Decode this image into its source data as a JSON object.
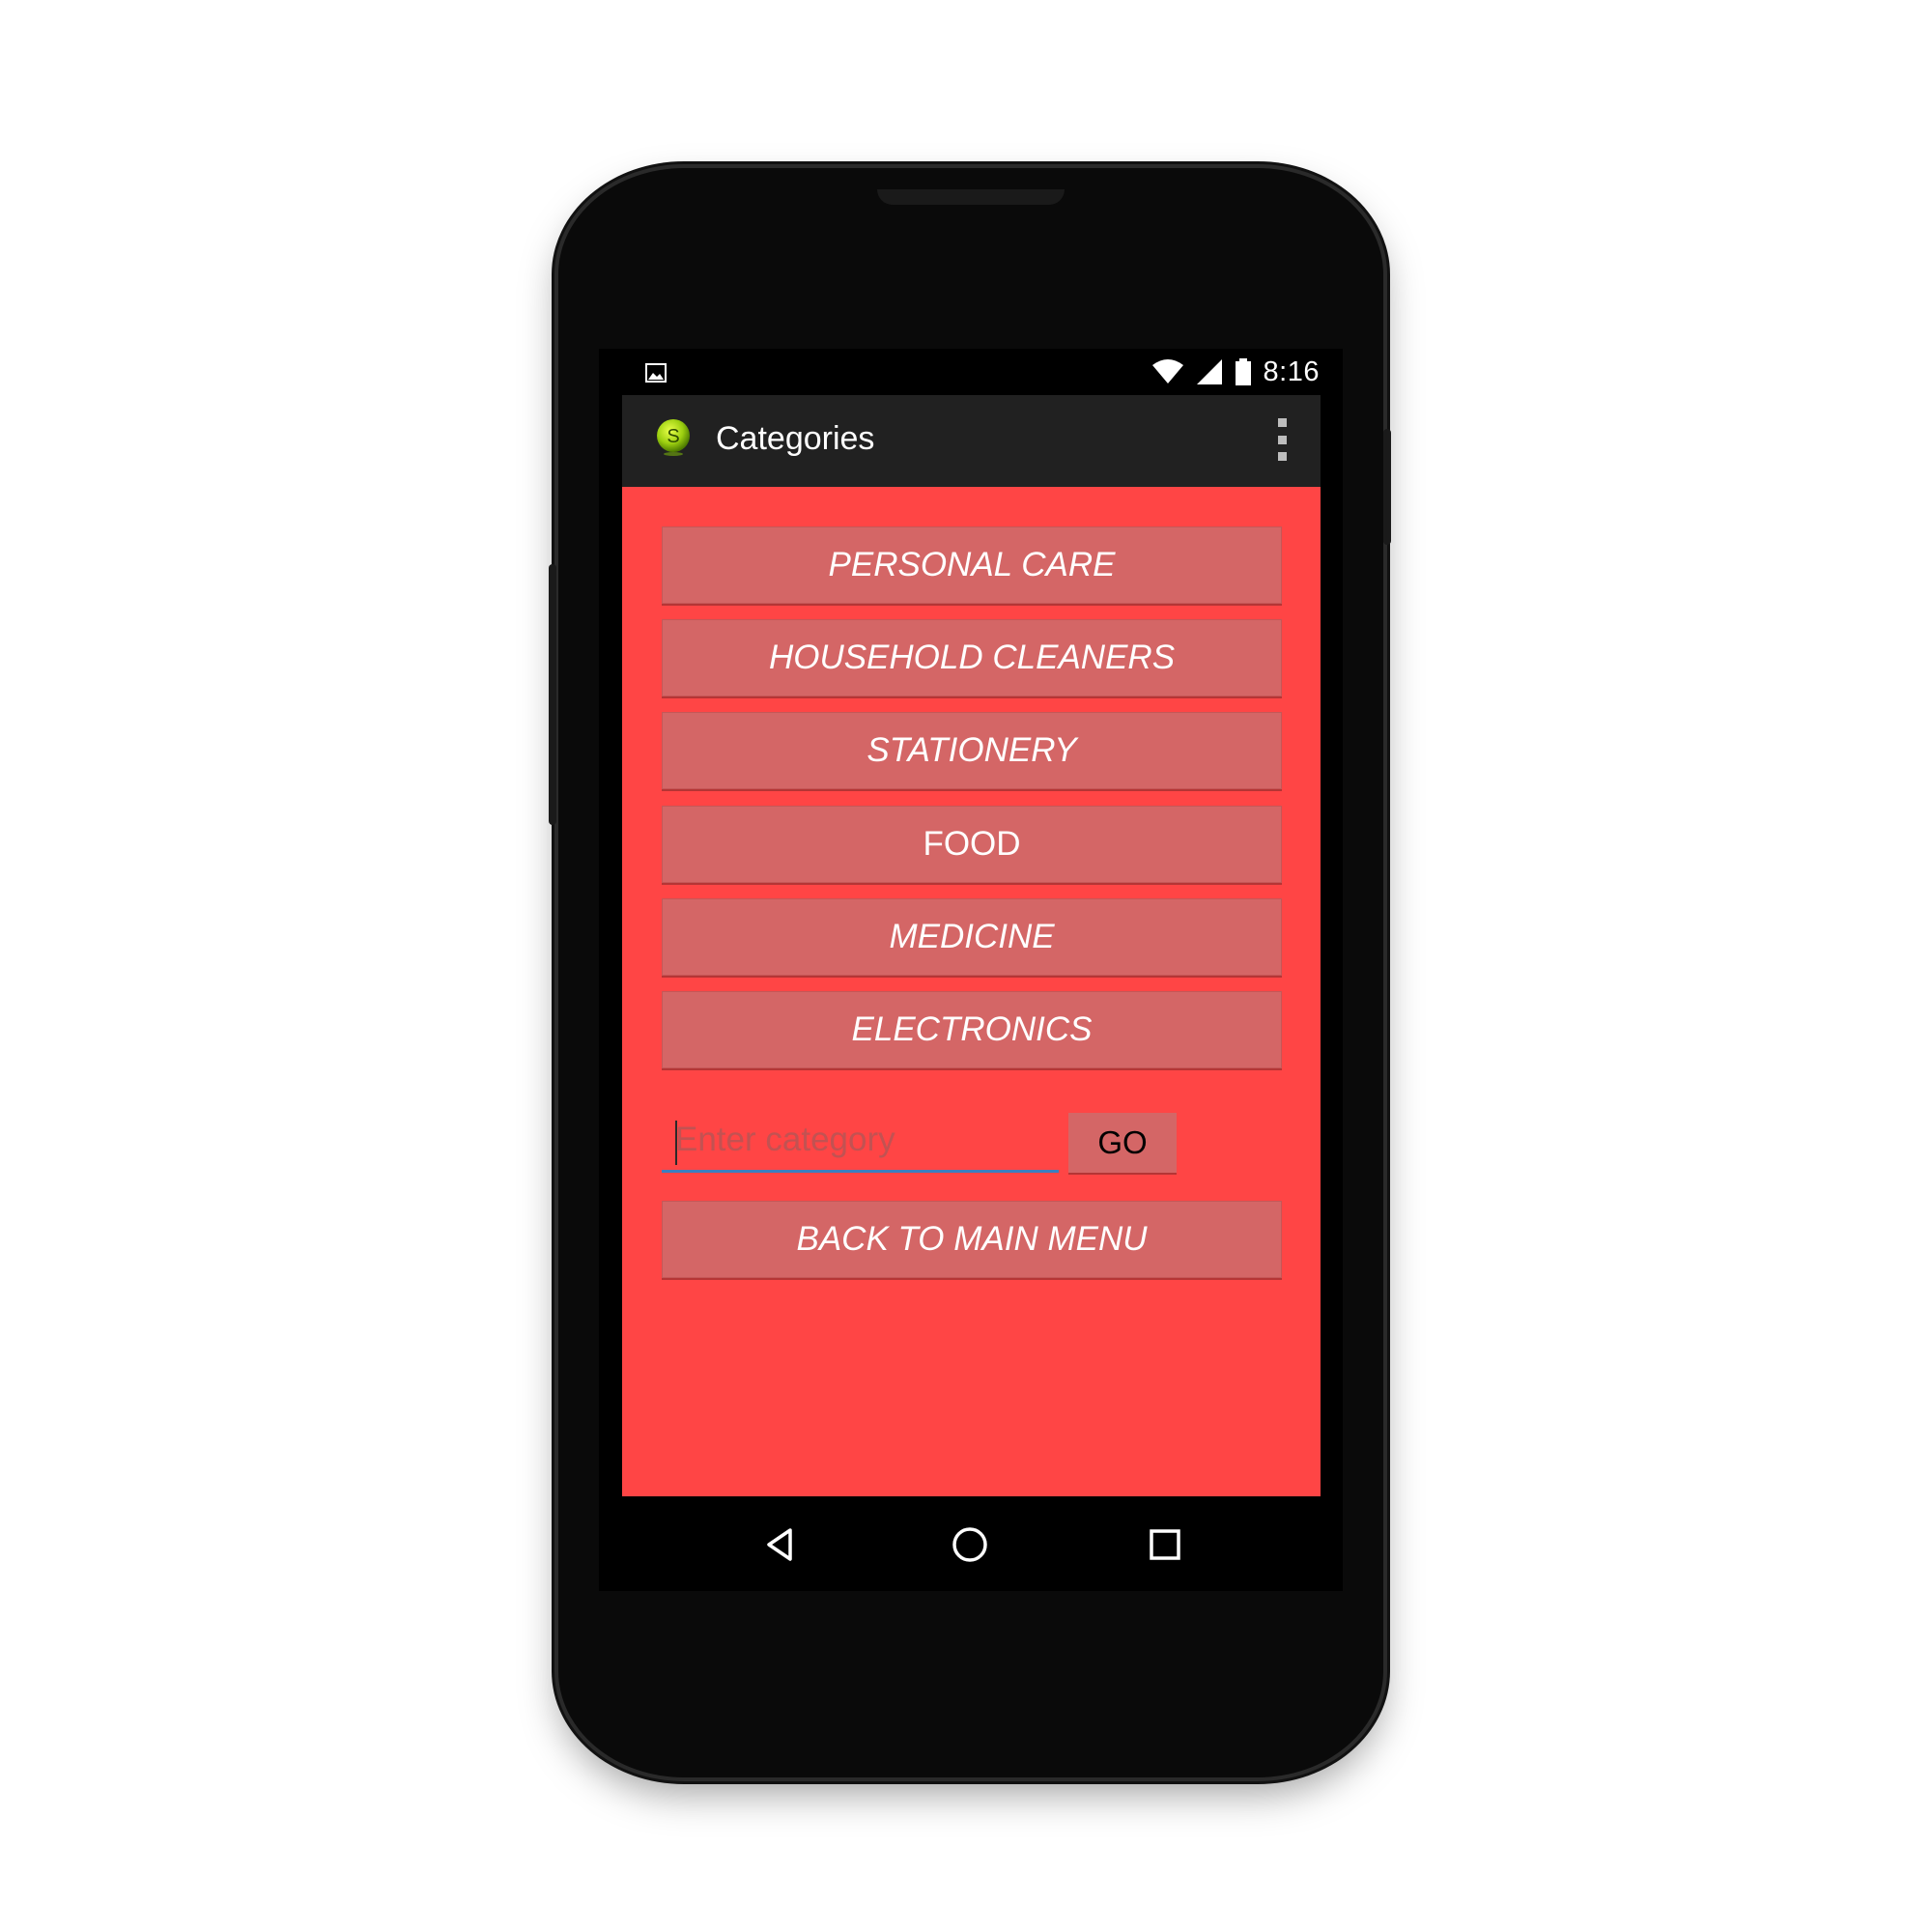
{
  "status_bar": {
    "time": "8:16",
    "icons": [
      "image-notification-icon",
      "wifi-icon",
      "cell-signal-icon",
      "battery-icon"
    ]
  },
  "action_bar": {
    "title": "Categories",
    "app_icon_letter": "S",
    "app_icon": "app-logo-icon",
    "overflow_icon": "overflow-menu-icon"
  },
  "colors": {
    "content_background": "#ff4545",
    "button_background": "#d46666",
    "action_bar_background": "#212121",
    "input_underline": "#3a7fc0"
  },
  "categories": [
    {
      "label": "PERSONAL CARE"
    },
    {
      "label": "HOUSEHOLD CLEANERS"
    },
    {
      "label": "STATIONERY"
    },
    {
      "label": "FOOD"
    },
    {
      "label": "MEDICINE"
    },
    {
      "label": "ELECTRONICS"
    }
  ],
  "search": {
    "placeholder": "Enter category",
    "value": "",
    "go_label": "GO"
  },
  "back_button": {
    "label": "BACK TO MAIN MENU"
  },
  "nav_bar": {
    "icons": [
      "back-icon",
      "home-icon",
      "recents-icon"
    ]
  }
}
